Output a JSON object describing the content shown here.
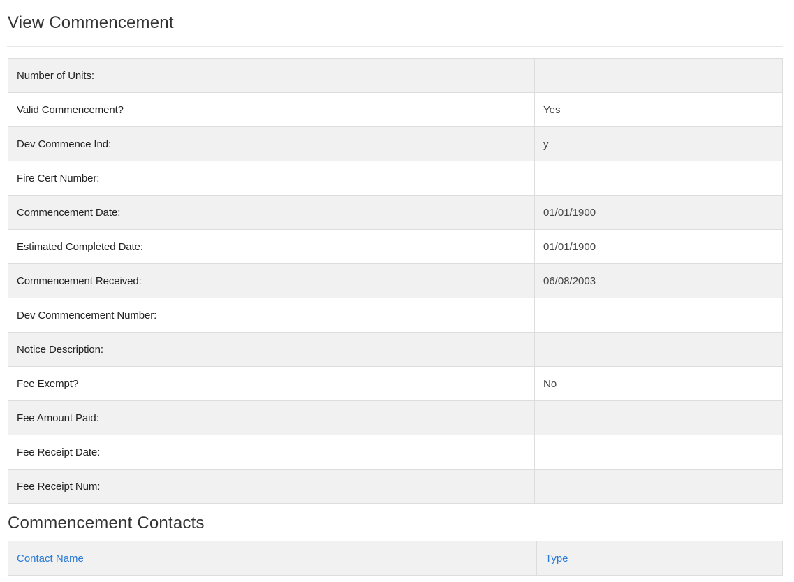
{
  "page": {
    "title": "View Commencement"
  },
  "details": {
    "rows": [
      {
        "label": "Number of Units:",
        "value": ""
      },
      {
        "label": "Valid Commencement?",
        "value": "Yes"
      },
      {
        "label": "Dev Commence Ind:",
        "value": "y"
      },
      {
        "label": "Fire Cert Number:",
        "value": ""
      },
      {
        "label": "Commencement Date:",
        "value": "01/01/1900"
      },
      {
        "label": "Estimated Completed Date:",
        "value": "01/01/1900"
      },
      {
        "label": "Commencement Received:",
        "value": "06/08/2003"
      },
      {
        "label": "Dev Commencement Number:",
        "value": ""
      },
      {
        "label": "Notice Description:",
        "value": ""
      },
      {
        "label": "Fee Exempt?",
        "value": "No"
      },
      {
        "label": "Fee Amount Paid:",
        "value": ""
      },
      {
        "label": "Fee Receipt Date:",
        "value": ""
      },
      {
        "label": "Fee Receipt Num:",
        "value": ""
      }
    ]
  },
  "contacts": {
    "title": "Commencement Contacts",
    "columns": {
      "name": "Contact Name",
      "type": "Type"
    },
    "link_color": "#2a7ad8"
  }
}
